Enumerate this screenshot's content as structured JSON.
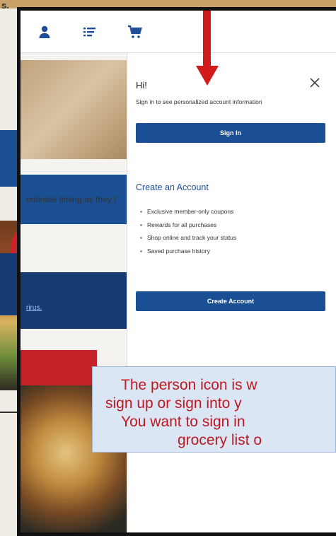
{
  "background": {
    "letter_top": "s.",
    "red_glyph": "("
  },
  "nav": {
    "icons": [
      "person-icon",
      "list-icon",
      "cart-icon"
    ],
    "accent": "#1e4f96"
  },
  "underlying_page": {
    "text_fragment": "ordinate timing as they l",
    "link_fragment": "rirus."
  },
  "panel": {
    "greeting": "Hi!",
    "subtitle": "Sign in to see personalized account information",
    "sign_in_label": "Sign In",
    "create_title": "Create an Account",
    "benefits": [
      "Exclusive member-only coupons",
      "Rewards for all purchases",
      "Shop online and track your status",
      "Saved purchase history"
    ],
    "create_label": "Create Account",
    "button_color": "#1b4f93"
  },
  "callout": {
    "lines": [
      "The person icon is w",
      "sign up or sign into y",
      "You want to sign in",
      "grocery list o"
    ],
    "text_color": "#c01820",
    "bg_color": "#dbe6f5"
  },
  "annotation_arrow_color": "#d11a1a"
}
